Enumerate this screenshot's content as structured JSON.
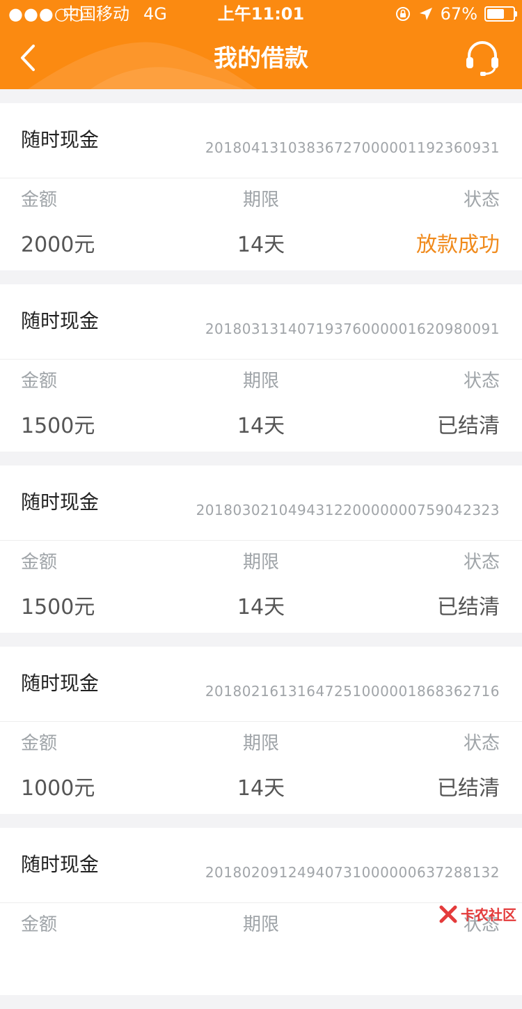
{
  "status_bar": {
    "signal": "●●●○○",
    "carrier": "中国移动",
    "network": "4G",
    "time": "上午11:01",
    "battery": "67%",
    "battery_level": 0.67
  },
  "header": {
    "title": "我的借款"
  },
  "loans": [
    {
      "product": "随时现金",
      "order_no": "20180413103836727000001192360931",
      "amount_label": "金额",
      "term_label": "期限",
      "status_label": "状态",
      "amount": "2000元",
      "term": "14天",
      "status": "放款成功",
      "status_color": "#f08a1c"
    },
    {
      "product": "随时现金",
      "order_no": "20180313140719376000001620980091",
      "amount_label": "金额",
      "term_label": "期限",
      "status_label": "状态",
      "amount": "1500元",
      "term": "14天",
      "status": "已结清",
      "status_color": "#555555"
    },
    {
      "product": "随时现金",
      "order_no": "201803021049431220000000759042323",
      "amount_label": "金额",
      "term_label": "期限",
      "status_label": "状态",
      "amount": "1500元",
      "term": "14天",
      "status": "已结清",
      "status_color": "#555555"
    },
    {
      "product": "随时现金",
      "order_no": "20180216131647251000001868362716",
      "amount_label": "金额",
      "term_label": "期限",
      "status_label": "状态",
      "amount": "1000元",
      "term": "14天",
      "status": "已结清",
      "status_color": "#555555"
    },
    {
      "product": "随时现金",
      "order_no": "20180209124940731000000637288132",
      "amount_label": "金额",
      "term_label": "期限",
      "status_label": "状态",
      "amount": "",
      "term": "",
      "status": "",
      "status_color": "#555555"
    }
  ],
  "watermark": {
    "text": "卡农社区"
  },
  "colors": {
    "primary": "#fb8a11",
    "accent": "#f08a1c",
    "background": "#f3f3f5"
  }
}
